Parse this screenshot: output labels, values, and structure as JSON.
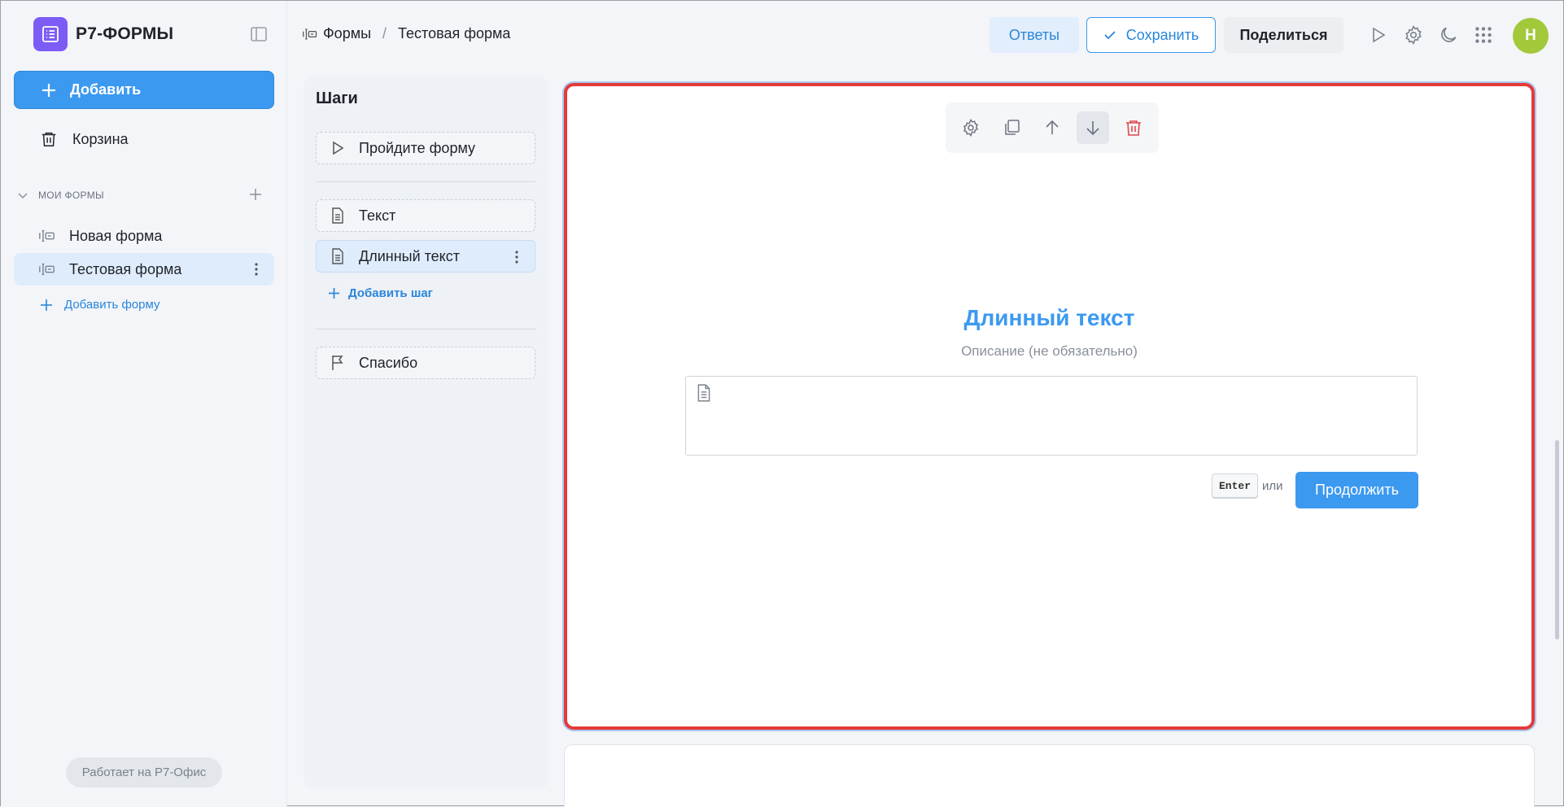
{
  "app": {
    "title": "Р7-ФОРМЫ"
  },
  "sidebar": {
    "add_label": "Добавить",
    "trash_label": "Корзина",
    "section_label": "МОИ ФОРМЫ",
    "forms": [
      {
        "label": "Новая форма",
        "active": false
      },
      {
        "label": "Тестовая форма",
        "active": true
      }
    ],
    "add_form_label": "Добавить форму",
    "powered_by": "Работает на Р7-Офис"
  },
  "header": {
    "breadcrumb": [
      "Формы",
      "Тестовая форма"
    ],
    "answers_label": "Ответы",
    "save_label": "Сохранить",
    "share_label": "Поделиться",
    "avatar_initial": "Н"
  },
  "steps": {
    "title": "Шаги",
    "start": "Пройдите форму",
    "items": [
      {
        "label": "Текст",
        "active": false
      },
      {
        "label": "Длинный текст",
        "active": true
      }
    ],
    "add_step_label": "Добавить шаг",
    "end": "Спасибо"
  },
  "question": {
    "title": "Длинный текст",
    "description_placeholder": "Описание (не обязательно)",
    "answer_value": "",
    "enter_hint": "Enter",
    "or_text": "или",
    "continue_label": "Продолжить"
  },
  "colors": {
    "accent": "#3b99f0",
    "logo": "#7c5cf5",
    "avatar": "#a3c93a",
    "selection_border": "#e53a3a",
    "delete": "#e04848"
  }
}
